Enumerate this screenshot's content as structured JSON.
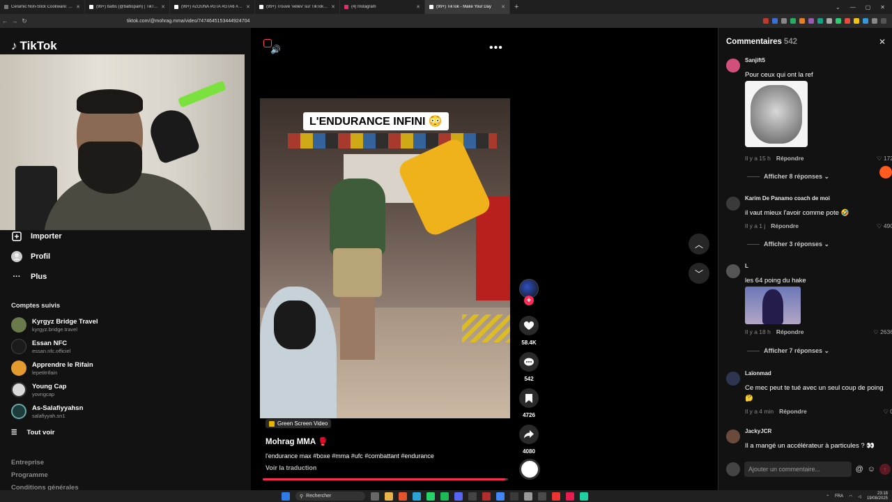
{
  "browser": {
    "tabs": [
      {
        "label": "Ceramic Non-Stick Cookware: Non-S",
        "active": false
      },
      {
        "label": "(99+) baltis (@baltispam) | TikTok",
        "active": false
      },
      {
        "label": "(99+) #ZOUNA #GTA #GTA6 #TRAILE",
        "active": false
      },
      {
        "label": "(99+) Trouvé 'veliev' sur TikTok | Rec",
        "active": false
      },
      {
        "label": "(4) Instagram",
        "active": false
      },
      {
        "label": "(99+) TikTok - Make Your Day",
        "active": true
      }
    ],
    "new_tab": "+",
    "url": "tiktok.com/@mohrag.mma/video/7474645153444924704"
  },
  "sidebar": {
    "logo": "TikTok",
    "nav": [
      {
        "label": "Importer",
        "icon": "plus-square-icon"
      },
      {
        "label": "Profil",
        "icon": "profile-icon"
      },
      {
        "label": "Plus",
        "icon": "more-horizontal-icon"
      }
    ],
    "followed_title": "Comptes suivis",
    "accounts": [
      {
        "name": "Kyrgyz Bridge Travel",
        "handle": "kyrgyz.bridge.travel",
        "color": "#6a7a4a"
      },
      {
        "name": "Essan NFC",
        "handle": "essan.nfc.officiel",
        "color": "#1b1b1b"
      },
      {
        "name": "Apprendre le Rifain",
        "handle": "lepetitrifain",
        "color": "#e39a2e"
      },
      {
        "name": "Young Cap",
        "handle": "yovngcap",
        "color": "#d9d9d9"
      },
      {
        "name": "As-Salafiyyahsn",
        "handle": "salafiyyah.sn1",
        "color": "#1d3b3a"
      }
    ],
    "see_all": "Tout voir",
    "footer": [
      "Entreprise",
      "Programme",
      "Conditions générales"
    ]
  },
  "video": {
    "overlay_caption": "L'ENDURANCE INFINI 😳",
    "source_badge": "Green Screen Video",
    "author": "Mohrag MMA 🥊",
    "description": "l'endurance max #boxe #mma #ufc #combattant #endurance",
    "translate": "Voir la traduction",
    "progress": 0.99,
    "actions": {
      "likes": "58.4K",
      "comments": "542",
      "saves": "4726",
      "shares": "4080"
    }
  },
  "comments": {
    "title": "Commentaires",
    "count": "542",
    "items": [
      {
        "user": "Sanjift5",
        "text": "Pour ceux qui ont la ref",
        "time": "Il y a 15 h",
        "reply": "Répondre",
        "likes": "172",
        "replies": "Afficher 8 réponses",
        "color": "#d0507a"
      },
      {
        "user": "Karim De Panamo coach de moi",
        "text": "il vaut mieux l'avoir comme pote 🤣",
        "time": "Il y a 1 j",
        "reply": "Répondre",
        "likes": "490",
        "replies": "Afficher 3 réponses",
        "color": "#3a3a3a"
      },
      {
        "user": "L",
        "text": "les 64 poing du hake",
        "time": "Il y a 18 h",
        "reply": "Répondre",
        "likes": "2636",
        "replies": "Afficher 7 réponses",
        "color": "#555"
      },
      {
        "user": "Laïonmad",
        "text": "Ce mec peut te tué avec un seul coup de poing 🤔",
        "time": "Il y a 4 min",
        "reply": "Répondre",
        "likes": "0",
        "color": "#2d3550"
      },
      {
        "user": "JackyJCR",
        "text": "Il a mangé un accélérateur à particules ? 👀",
        "color": "#6a4a3a"
      }
    ],
    "input_placeholder": "Ajouter un commentaire..."
  },
  "taskbar": {
    "search": "Rechercher",
    "lang": "FRA",
    "time": "23:18",
    "date": "19/08/2025"
  }
}
